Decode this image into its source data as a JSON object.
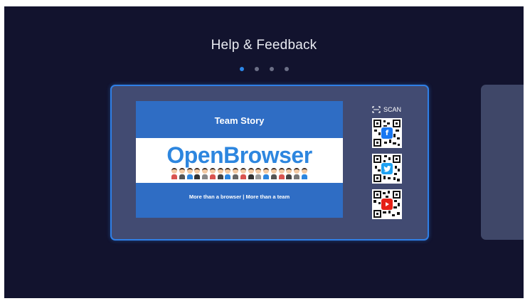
{
  "page": {
    "title": "Help & Feedback"
  },
  "pager": {
    "total": 4,
    "active_index": 0
  },
  "card": {
    "banner": {
      "heading": "Team Story",
      "brand": "OpenBrowser",
      "tagline": "More than a browser | More than a team"
    },
    "scan_label": "SCAN",
    "qr_codes": [
      {
        "network": "facebook",
        "icon": "facebook-icon",
        "glyph": "f",
        "color": "#1877f2"
      },
      {
        "network": "twitter",
        "icon": "twitter-icon",
        "glyph": "🐦",
        "color": "#1da1f2"
      },
      {
        "network": "youtube",
        "icon": "youtube-icon",
        "glyph": "▶",
        "color": "#e62117"
      }
    ]
  },
  "colors": {
    "background": "#12132e",
    "accent": "#2f7fe6",
    "card": "#424b72",
    "banner": "#2f6dc4"
  }
}
